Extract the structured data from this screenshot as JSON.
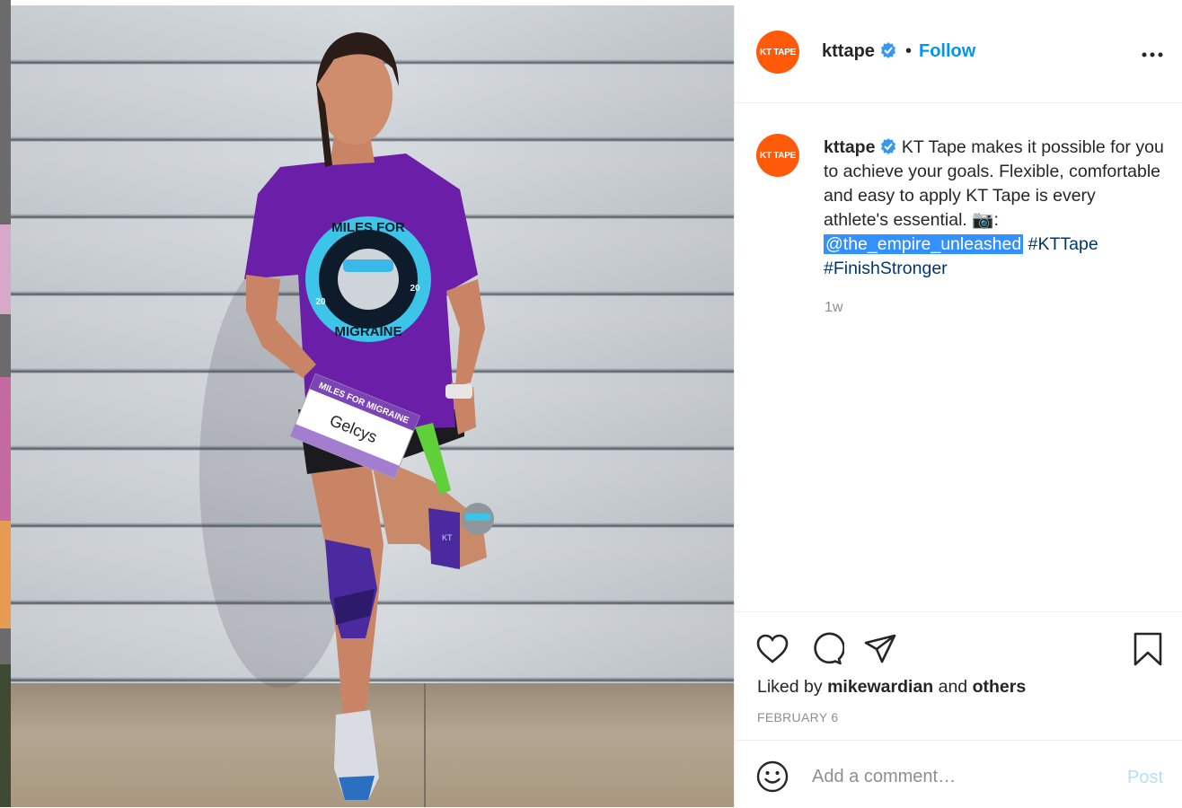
{
  "post": {
    "username": "kttape",
    "avatar_text": "KT TAPE",
    "follow_label": "Follow",
    "separator": "•",
    "caption_username": "kttape",
    "caption_text": " KT Tape makes it possible for you to achieve your goals. Flexible, comfortable and easy to apply KT Tape is every athlete's essential. 📷:",
    "mention": "@the_empire_unleashed",
    "hashtags": [
      "#KTTape",
      "#FinishStronger"
    ],
    "time_ago": "1w",
    "liked_by_prefix": "Liked by ",
    "liked_by_user": "mikewardian",
    "liked_by_mid": " and ",
    "liked_by_others": "others",
    "date": "FEBRUARY 6"
  },
  "comment": {
    "placeholder": "Add a comment…",
    "post_label": "Post"
  },
  "photo": {
    "shirt_text_top": "MILES FOR",
    "shirt_text_bottom": "MIGRAINE",
    "shirt_year_left": "20",
    "shirt_year_right": "20",
    "bib_header": "MILES FOR MIGRAINE",
    "bib_name": "Gelcys",
    "tape_letters": "KT"
  },
  "colors": {
    "accent_blue": "#0095f6",
    "brand_orange": "#ff5a0a",
    "shirt_purple": "#6b1fa8",
    "tape_purple": "#4b2aa0"
  }
}
